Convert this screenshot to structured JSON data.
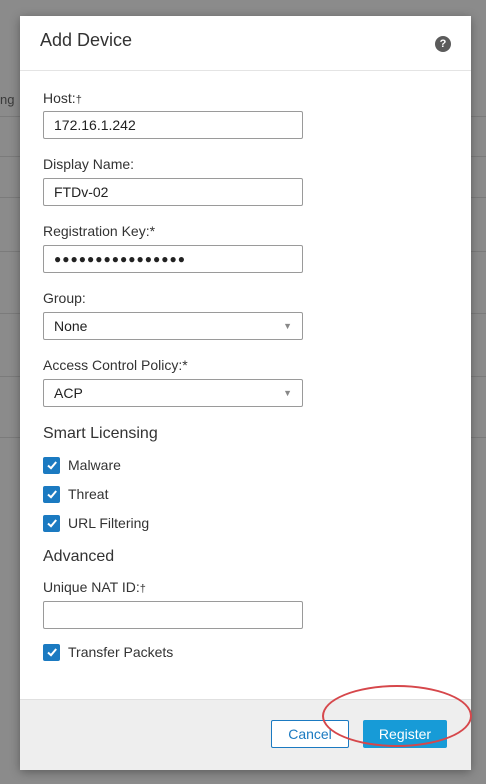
{
  "background": {
    "partial_text": "ng"
  },
  "modal": {
    "title": "Add Device",
    "help_icon": "question-circle-icon",
    "fields": {
      "host": {
        "label": "Host:",
        "marker": "†",
        "value": "172.16.1.242"
      },
      "display_name": {
        "label": "Display Name:",
        "value": "FTDv-02"
      },
      "registration_key": {
        "label": "Registration Key:*",
        "value": "●●●●●●●●●●●●●●●●"
      },
      "group": {
        "label": "Group:",
        "value": "None"
      },
      "access_control_policy": {
        "label": "Access Control Policy:*",
        "value": "ACP"
      },
      "unique_nat_id": {
        "label": "Unique NAT ID:",
        "marker": "†",
        "value": ""
      }
    },
    "smart_licensing": {
      "title": "Smart Licensing",
      "options": [
        {
          "label": "Malware",
          "checked": true
        },
        {
          "label": "Threat",
          "checked": true
        },
        {
          "label": "URL Filtering",
          "checked": true
        }
      ]
    },
    "advanced": {
      "title": "Advanced",
      "transfer_packets": {
        "label": "Transfer Packets",
        "checked": true
      }
    },
    "footer": {
      "cancel_label": "Cancel",
      "register_label": "Register"
    }
  },
  "colors": {
    "accent": "#1b7ac1",
    "primary_button": "#179bd7",
    "highlight": "#d6474b",
    "overlay": "#8b8b8b"
  }
}
